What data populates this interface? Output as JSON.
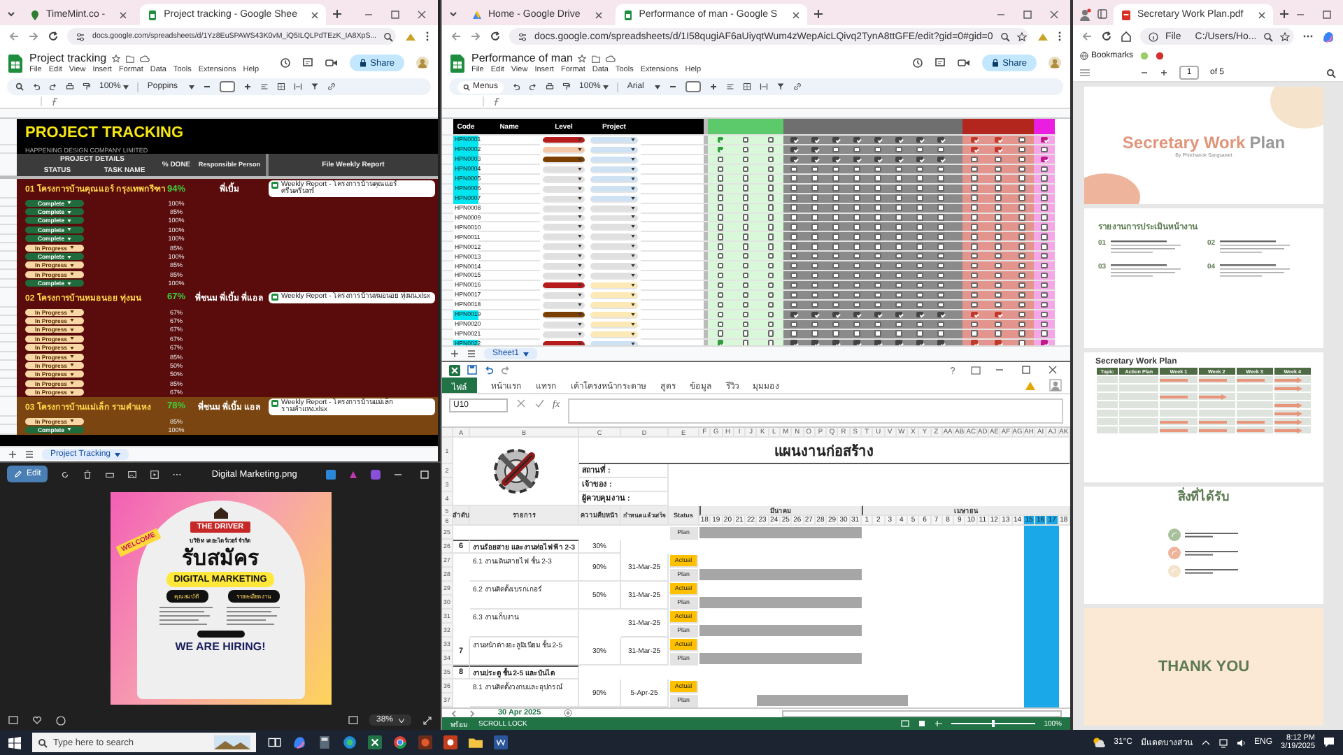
{
  "project_tracking_window": {
    "tabs": [
      {
        "title": "TimeMint.co -",
        "selected": false
      },
      {
        "title": "Project tracking - Google Shee",
        "selected": true
      }
    ],
    "url": "docs.google.com/spreadsheets/d/1Yz8EuSPAWS43K0vM_iQ5ILQLPdTEzK_IA8XpS...",
    "doc_title": "Project tracking",
    "menus": [
      "File",
      "Edit",
      "View",
      "Insert",
      "Format",
      "Data",
      "Tools",
      "Extensions",
      "Help"
    ],
    "share": "Share",
    "zoom": "100%",
    "font": "Poppins",
    "sheet": {
      "title": "PROJECT TRACKING",
      "company": "HAPPENING DESIGN COMPANY LIMITED",
      "details": "PROJECT DETAILS",
      "status": "STATUS",
      "task": "TASK NAME",
      "done": "% DONE",
      "person": "Responsible Person",
      "report": "File Weekly Report",
      "projects": [
        {
          "name": "01 โครงการบ้านคุณแอร์ กรุงเทพกรีฑา",
          "done": "94%",
          "person": "พี่เบิ้ม",
          "report": "Weekly Report - โครงการบ้านคุณแอร์ ศรีนครินทร์",
          "color": "#5a0b0b",
          "tasks": [
            {
              "kind": "complete",
              "status": "Complete",
              "done": "100%"
            },
            {
              "kind": "complete",
              "status": "Complete",
              "done": "85%"
            },
            {
              "kind": "complete",
              "status": "Complete",
              "done": "100%"
            },
            {
              "kind": "complete",
              "status": "Complete",
              "done": "100%"
            },
            {
              "kind": "complete",
              "status": "Complete",
              "done": "100%"
            },
            {
              "kind": "progress",
              "status": "In Progress",
              "done": "85%"
            },
            {
              "kind": "complete",
              "status": "Complete",
              "done": "100%"
            },
            {
              "kind": "progress",
              "status": "In Progress",
              "done": "85%"
            },
            {
              "kind": "progress",
              "status": "In Progress",
              "done": "85%"
            },
            {
              "kind": "complete",
              "status": "Complete",
              "done": "100%"
            }
          ]
        },
        {
          "name": "02 โครงการบ้านหมอนอย ทุ่งมน",
          "done": "67%",
          "person": "พี่ชนม พี่เบิ้ม พี่แอล",
          "report": "Weekly Report - โครงการบ้านหมอนอย ทุ่งมน.xlsx",
          "color": "#5a0b0b",
          "tasks": [
            {
              "kind": "progress",
              "status": "In Progress",
              "done": "67%"
            },
            {
              "kind": "progress",
              "status": "In Progress",
              "done": "67%"
            },
            {
              "kind": "progress",
              "status": "In Progress",
              "done": "67%"
            },
            {
              "kind": "progress",
              "status": "In Progress",
              "done": "67%"
            },
            {
              "kind": "progress",
              "status": "In Progress",
              "done": "67%"
            },
            {
              "kind": "progress",
              "status": "In Progress",
              "done": "85%"
            },
            {
              "kind": "progress",
              "status": "In Progress",
              "done": "50%"
            },
            {
              "kind": "progress",
              "status": "In Progress",
              "done": "50%"
            },
            {
              "kind": "progress",
              "status": "In Progress",
              "done": "85%"
            },
            {
              "kind": "progress",
              "status": "In Progress",
              "done": "67%"
            }
          ]
        },
        {
          "name": "03 โครงการบ้านแม่เล็ก รามคำแหง",
          "done": "78%",
          "person": "พี่ชนม พี่เบิ้ม แอล",
          "report": "Weekly Report - โครงการบ้านแม่เล็ก รามคำแหง.xlsx",
          "color": "#7a4510",
          "tasks": [
            {
              "kind": "progress",
              "status": "In Progress",
              "done": "85%"
            },
            {
              "kind": "complete",
              "status": "Complete",
              "done": "100%"
            }
          ]
        }
      ]
    },
    "sheet_tab": "Project Tracking"
  },
  "performance_window": {
    "tabs": [
      {
        "title": "Home - Google Drive",
        "selected": false
      },
      {
        "title": "Performance of man - Google S",
        "selected": true
      }
    ],
    "url": "docs.google.com/spreadsheets/d/1I58qugiAF6aUiyqtWum4zWepAicLQivq2TynA8ttGFE/edit?gid=0#gid=0",
    "doc_title": "Performance of man",
    "menus": [
      "File",
      "Edit",
      "View",
      "Insert",
      "Format",
      "Data",
      "Tools",
      "Extensions",
      "Help"
    ],
    "share": "Share",
    "menus_search": "Menus",
    "zoom": "100%",
    "font": "Arial",
    "columns": [
      "Code",
      "Name",
      "Level",
      "Project"
    ],
    "rows": [
      {
        "code": "HPN0001",
        "highlight": true,
        "level_tag": {
          "color": "#b71c1c"
        },
        "project_tag": {
          "color": "#cfe2f3"
        },
        "checks": [
          true,
          false,
          false,
          true,
          true,
          true,
          true,
          true,
          true,
          true,
          true,
          true,
          true,
          false,
          true
        ]
      },
      {
        "code": "HPN0002",
        "highlight": true,
        "level_tag": {
          "color": "#f4c7a6"
        },
        "project_tag": {
          "color": "#cfe2f3"
        },
        "checks": [
          true,
          false,
          false,
          true,
          true,
          false,
          false,
          false,
          false,
          false,
          false,
          true,
          true,
          false,
          false
        ]
      },
      {
        "code": "HPN0003",
        "highlight": true,
        "level_tag": {
          "color": "#7b3f00"
        },
        "project_tag": {
          "color": "#cfe2f3"
        },
        "checks": [
          false,
          false,
          false,
          true,
          true,
          true,
          true,
          true,
          true,
          true,
          true,
          false,
          false,
          false,
          true
        ]
      },
      {
        "code": "HPN0004",
        "highlight": true,
        "level_tag": {
          "color": "#e0e0e0"
        },
        "project_tag": {
          "color": "#cfe2f3"
        },
        "checks": [
          false,
          false,
          false,
          false,
          false,
          false,
          false,
          false,
          false,
          false,
          false,
          false,
          false,
          false,
          false
        ]
      },
      {
        "code": "HPN0005",
        "highlight": true,
        "level_tag": {
          "color": "#e0e0e0"
        },
        "project_tag": {
          "color": "#cfe2f3"
        },
        "checks": [
          false,
          false,
          false,
          false,
          false,
          false,
          false,
          false,
          false,
          false,
          false,
          false,
          false,
          false,
          false
        ]
      },
      {
        "code": "HPN0006",
        "highlight": true,
        "level_tag": {
          "color": "#e0e0e0"
        },
        "project_tag": {
          "color": "#cfe2f3"
        },
        "checks": [
          false,
          false,
          false,
          false,
          false,
          false,
          false,
          false,
          false,
          false,
          false,
          false,
          false,
          false,
          false
        ]
      },
      {
        "code": "HPN0007",
        "highlight": true,
        "level_tag": {
          "color": "#e0e0e0"
        },
        "project_tag": {
          "color": "#cfe2f3"
        },
        "checks": [
          false,
          false,
          false,
          false,
          false,
          false,
          false,
          false,
          false,
          false,
          false,
          false,
          false,
          false,
          false
        ]
      },
      {
        "code": "HPN0008",
        "highlight": false,
        "level_tag": {
          "color": "#e0e0e0"
        },
        "project_tag": {
          "color": "#e0e0e0"
        },
        "checks": [
          false,
          false,
          false,
          false,
          false,
          false,
          false,
          false,
          false,
          false,
          false,
          false,
          false,
          false,
          false
        ]
      },
      {
        "code": "HPN0009",
        "highlight": false,
        "level_tag": {
          "color": "#e0e0e0"
        },
        "project_tag": {
          "color": "#e0e0e0"
        },
        "checks": [
          false,
          false,
          false,
          false,
          false,
          false,
          false,
          false,
          false,
          false,
          false,
          false,
          false,
          false,
          false
        ]
      },
      {
        "code": "HPN0010",
        "highlight": false,
        "level_tag": {
          "color": "#e0e0e0"
        },
        "project_tag": {
          "color": "#e0e0e0"
        },
        "checks": [
          false,
          false,
          false,
          false,
          false,
          false,
          false,
          false,
          false,
          false,
          false,
          false,
          false,
          false,
          false
        ]
      },
      {
        "code": "HPN0011",
        "highlight": false,
        "level_tag": {
          "color": "#e0e0e0"
        },
        "project_tag": {
          "color": "#e0e0e0"
        },
        "checks": [
          false,
          false,
          false,
          false,
          false,
          false,
          false,
          false,
          false,
          false,
          false,
          false,
          false,
          false,
          false
        ]
      },
      {
        "code": "HPN0012",
        "highlight": false,
        "level_tag": {
          "color": "#e0e0e0"
        },
        "project_tag": {
          "color": "#e0e0e0"
        },
        "checks": [
          false,
          false,
          false,
          false,
          false,
          false,
          false,
          false,
          false,
          false,
          false,
          false,
          false,
          false,
          false
        ]
      },
      {
        "code": "HPN0013",
        "highlight": false,
        "level_tag": {
          "color": "#e0e0e0"
        },
        "project_tag": {
          "color": "#e0e0e0"
        },
        "checks": [
          false,
          false,
          false,
          false,
          false,
          false,
          false,
          false,
          false,
          false,
          false,
          false,
          false,
          false,
          false
        ]
      },
      {
        "code": "HPN0014",
        "highlight": false,
        "level_tag": {
          "color": "#e0e0e0"
        },
        "project_tag": {
          "color": "#e0e0e0"
        },
        "checks": [
          false,
          false,
          false,
          false,
          false,
          false,
          false,
          false,
          false,
          false,
          false,
          false,
          false,
          false,
          false
        ]
      },
      {
        "code": "HPN0015",
        "highlight": false,
        "level_tag": {
          "color": "#e0e0e0"
        },
        "project_tag": {
          "color": "#e0e0e0"
        },
        "checks": [
          false,
          false,
          false,
          false,
          false,
          false,
          false,
          false,
          false,
          false,
          false,
          false,
          false,
          false,
          false
        ]
      },
      {
        "code": "HPN0016",
        "highlight": false,
        "level_tag": {
          "color": "#b71c1c"
        },
        "project_tag": {
          "color": "#fde9b5"
        },
        "checks": [
          false,
          false,
          false,
          false,
          false,
          false,
          false,
          false,
          false,
          false,
          false,
          false,
          false,
          false,
          false
        ]
      },
      {
        "code": "HPN0017",
        "highlight": false,
        "level_tag": {
          "color": "#e0e0e0"
        },
        "project_tag": {
          "color": "#fde9b5"
        },
        "checks": [
          false,
          false,
          false,
          false,
          false,
          false,
          false,
          false,
          false,
          false,
          false,
          false,
          false,
          false,
          false
        ]
      },
      {
        "code": "HPN0018",
        "highlight": false,
        "level_tag": {
          "color": "#e0e0e0"
        },
        "project_tag": {
          "color": "#fde9b5"
        },
        "checks": [
          false,
          false,
          false,
          false,
          false,
          false,
          false,
          false,
          false,
          false,
          false,
          false,
          false,
          false,
          false
        ]
      },
      {
        "code": "HPN0019",
        "highlight": true,
        "level_tag": {
          "color": "#7b3f00"
        },
        "project_tag": {
          "color": "#fde9b5"
        },
        "checks": [
          false,
          false,
          false,
          true,
          true,
          true,
          true,
          true,
          true,
          true,
          true,
          true,
          true,
          false,
          false
        ]
      },
      {
        "code": "HPN0020",
        "highlight": false,
        "level_tag": {
          "color": "#e0e0e0"
        },
        "project_tag": {
          "color": "#fde9b5"
        },
        "checks": [
          false,
          false,
          false,
          false,
          false,
          false,
          false,
          false,
          false,
          false,
          false,
          false,
          false,
          false,
          false
        ]
      },
      {
        "code": "HPN0021",
        "highlight": false,
        "level_tag": {
          "color": "#e0e0e0"
        },
        "project_tag": {
          "color": "#fde9b5"
        },
        "checks": [
          false,
          false,
          false,
          false,
          false,
          false,
          false,
          false,
          false,
          false,
          false,
          false,
          false,
          false,
          false
        ]
      },
      {
        "code": "HPN0022",
        "highlight": true,
        "level_tag": {
          "color": "#b71c1c"
        },
        "project_tag": {
          "color": "#cfe2f3"
        },
        "checks": [
          true,
          false,
          false,
          true,
          true,
          true,
          true,
          true,
          true,
          true,
          true,
          true,
          true,
          false,
          true
        ]
      }
    ],
    "sheet_tab": "Sheet1"
  },
  "photos_window": {
    "edit": "Edit",
    "file_name": "Digital Marketing.png",
    "zoom": "38%",
    "poster": {
      "brand": "THE DRIVER",
      "company": "บริษัท เดอะไดร์เวอร์ จำกัด",
      "headline": "รับสมัคร",
      "position": "DIGITAL MARKETING",
      "welcome": "WELCOME",
      "left_heading": "คุณสมบัติ",
      "right_heading": "รายละเอียดงาน",
      "hiring": "WE ARE HIRING!"
    }
  },
  "excel_window": {
    "ribbon_tabs": [
      {
        "label": "ไฟล์",
        "selected": true
      },
      {
        "label": "หน้าแรก",
        "selected": false
      },
      {
        "label": "แทรก",
        "selected": false
      },
      {
        "label": "เค้าโครงหน้ากระดาษ",
        "selected": false
      },
      {
        "label": "สูตร",
        "selected": false
      },
      {
        "label": "ข้อมูล",
        "selected": false
      },
      {
        "label": "รีวิว",
        "selected": false
      },
      {
        "label": "มุมมอง",
        "selected": false
      }
    ],
    "name_box": "U10",
    "formula_label": "fx",
    "columns": [
      "A",
      "B",
      "C",
      "D",
      "E"
    ],
    "top_rows": [
      "1",
      "2",
      "3",
      "4",
      "5",
      "6"
    ],
    "title": "แผนงานก่อสร้าง",
    "info_labels": [
      "สถานที่ :",
      "เจ้าของ :",
      "ผู้ควบคุมงาน :"
    ],
    "headers": {
      "no": "ลำดับ",
      "item": "รายการ",
      "progress": "ความคืบหน้า",
      "due": "กำหนดแล้วเสร็จ",
      "status": "Status"
    },
    "months": [
      {
        "label": "มีนาคม",
        "days": [
          {
            "letter": "F",
            "day": "18",
            "highlight": false
          },
          {
            "letter": "G",
            "day": "19",
            "highlight": false
          },
          {
            "letter": "H",
            "day": "20",
            "highlight": false
          },
          {
            "letter": "I",
            "day": "21",
            "highlight": false
          },
          {
            "letter": "J",
            "day": "22",
            "highlight": false
          },
          {
            "letter": "K",
            "day": "23",
            "highlight": false
          },
          {
            "letter": "L",
            "day": "24",
            "highlight": false
          },
          {
            "letter": "M",
            "day": "25",
            "highlight": false
          },
          {
            "letter": "N",
            "day": "26",
            "highlight": false
          },
          {
            "letter": "O",
            "day": "27",
            "highlight": false
          },
          {
            "letter": "P",
            "day": "28",
            "highlight": false
          },
          {
            "letter": "Q",
            "day": "29",
            "highlight": false
          },
          {
            "letter": "R",
            "day": "30",
            "highlight": false
          },
          {
            "letter": "S",
            "day": "31",
            "highlight": false
          }
        ]
      },
      {
        "label": "เมษายน",
        "days": [
          {
            "letter": "T",
            "day": "1",
            "highlight": false
          },
          {
            "letter": "U",
            "day": "2",
            "highlight": false
          },
          {
            "letter": "V",
            "day": "3",
            "highlight": false
          },
          {
            "letter": "W",
            "day": "4",
            "highlight": false
          },
          {
            "letter": "X",
            "day": "5",
            "highlight": false
          },
          {
            "letter": "Y",
            "day": "6",
            "highlight": false
          },
          {
            "letter": "Z",
            "day": "7",
            "highlight": false
          },
          {
            "letter": "AA",
            "day": "8",
            "highlight": false
          },
          {
            "letter": "AB",
            "day": "9",
            "highlight": false
          },
          {
            "letter": "AC",
            "day": "10",
            "highlight": false
          },
          {
            "letter": "AD",
            "day": "11",
            "highlight": false
          },
          {
            "letter": "AE",
            "day": "12",
            "highlight": false
          },
          {
            "letter": "AF",
            "day": "13",
            "highlight": false
          },
          {
            "letter": "AG",
            "day": "14",
            "highlight": false
          },
          {
            "letter": "AH",
            "day": "15",
            "highlight": true
          },
          {
            "letter": "AI",
            "day": "16",
            "highlight": true
          },
          {
            "letter": "AJ",
            "day": "17",
            "highlight": true
          },
          {
            "letter": "AK",
            "day": "18",
            "highlight": false
          }
        ]
      }
    ],
    "rows": [
      {
        "kind": "plan",
        "rows": [
          "25"
        ],
        "status": "Plan",
        "plan": [
          true,
          true,
          true,
          true,
          true,
          true,
          true,
          true,
          true,
          true,
          true,
          true,
          true,
          true,
          false,
          false,
          false,
          false,
          false,
          false,
          false,
          false,
          false,
          false,
          false,
          false,
          false,
          false,
          false,
          false,
          false,
          false
        ]
      },
      {
        "kind": "group",
        "rows": [
          "26"
        ],
        "no": "6",
        "title": "งานร้อยสาย และงานท่อไฟฟ้า 2-3",
        "done": "30%"
      },
      {
        "kind": "task",
        "rows": [
          "27",
          "28"
        ],
        "title": "6.1 งานเดินสายไฟ ชั้น 2-3",
        "done": "90%",
        "due": "31-Mar-25",
        "actual": "Actual",
        "status": "Plan",
        "plan": [
          true,
          true,
          true,
          true,
          true,
          true,
          true,
          true,
          true,
          true,
          true,
          true,
          true,
          true,
          false,
          false,
          false,
          false,
          false,
          false,
          false,
          false,
          false,
          false,
          false,
          false,
          false,
          false,
          false,
          false,
          false,
          false
        ]
      },
      {
        "kind": "task",
        "rows": [
          "29",
          "30"
        ],
        "title": "6.2 งานติดตั้งเบรกเกอร์",
        "done": "50%",
        "due": "31-Mar-25",
        "actual": "Actual",
        "status": "Plan",
        "plan": [
          true,
          true,
          true,
          true,
          true,
          true,
          true,
          true,
          true,
          true,
          true,
          true,
          true,
          true,
          false,
          false,
          false,
          false,
          false,
          false,
          false,
          false,
          false,
          false,
          false,
          false,
          false,
          false,
          false,
          false,
          false,
          false
        ]
      },
      {
        "kind": "task",
        "rows": [
          "31",
          "32"
        ],
        "title": "6.3 งานเก็บงาน",
        "due": "31-Mar-25",
        "actual": "Actual",
        "status": "Plan",
        "plan": [
          true,
          true,
          true,
          true,
          true,
          true,
          true,
          true,
          true,
          true,
          true,
          true,
          true,
          true,
          false,
          false,
          false,
          false,
          false,
          false,
          false,
          false,
          false,
          false,
          false,
          false,
          false,
          false,
          false,
          false,
          false,
          false
        ]
      },
      {
        "kind": "task",
        "rows": [
          "33",
          "34"
        ],
        "no": "7",
        "title": "งานหน้าต่างอะลูมิเนียม ชั้น 2-5",
        "done": "30%",
        "due": "31-Mar-25",
        "actual": "Actual",
        "status": "Plan",
        "plan": [
          true,
          true,
          true,
          true,
          true,
          true,
          true,
          true,
          true,
          true,
          true,
          true,
          true,
          true,
          false,
          false,
          false,
          false,
          false,
          false,
          false,
          false,
          false,
          false,
          false,
          false,
          false,
          false,
          false,
          false,
          false,
          false
        ]
      },
      {
        "kind": "group",
        "rows": [
          "35"
        ],
        "no": "8",
        "title": "งานประตู ชั้น 2-5 และบันได"
      },
      {
        "kind": "task",
        "rows": [
          "36",
          "37"
        ],
        "title": "8.1 งานติดตั้งวงกบและอุปกรณ์",
        "done": "90%",
        "due": "5-Apr-25",
        "actual": "Actual",
        "status": "Plan",
        "plan": [
          false,
          false,
          false,
          false,
          false,
          true,
          true,
          true,
          true,
          true,
          true,
          true,
          true,
          true,
          true,
          true,
          true,
          true,
          false,
          false,
          false,
          false,
          false,
          false,
          false,
          false,
          false,
          false,
          false,
          false,
          false,
          false
        ]
      }
    ],
    "sheet_tab": "30 Apr 2025",
    "status_ready": "พร้อม",
    "status_lock": "SCROLL LOCK",
    "zoom_slider": {
      "level": 0.5
    },
    "zoom": "100%"
  },
  "pdf_window": {
    "tabs": [
      {
        "title": "Secretary Work Plan.pdf",
        "selected": true
      }
    ],
    "address_scheme": "File",
    "address": "C:/Users/Ho...",
    "bookmarks": "Bookmarks",
    "page": "1",
    "page_total": "of 5",
    "cover": {
      "title_main": "Secretary Work",
      "title_accent": "Plan",
      "byline": "By Phitchanok Sangsawet"
    },
    "review": {
      "heading": "รายงานการประเมินหน้างาน",
      "numbers": [
        "01",
        "02",
        "03",
        "04"
      ]
    },
    "plan": {
      "title": "Secretary Work Plan",
      "columns": [
        "Topic",
        "Action Plan",
        "Week 1",
        "Week 2",
        "Week 3",
        "Week 4"
      ],
      "rows": [
        {
          "weeks": [
            true,
            true,
            true,
            true
          ]
        },
        {
          "weeks": [
            false,
            false,
            false,
            true
          ]
        },
        {
          "weeks": [
            true,
            true,
            false,
            false
          ]
        },
        {
          "weeks": [
            false,
            false,
            false,
            true
          ]
        },
        {
          "weeks": [
            false,
            false,
            false,
            true
          ]
        },
        {
          "weeks": [
            true,
            true,
            true,
            true
          ]
        },
        {
          "weeks": [
            true,
            true,
            true,
            true
          ]
        }
      ]
    },
    "benefits": {
      "heading": "สิ่งที่ได้รับ"
    },
    "closing": {
      "text": "THANK YOU"
    }
  },
  "taskbar": {
    "search_placeholder": "Type here to search",
    "temperature": "31°C",
    "weather": "มีแดดบางส่วน",
    "language": "ENG",
    "time": "8:12 PM",
    "date": "3/19/2025"
  }
}
